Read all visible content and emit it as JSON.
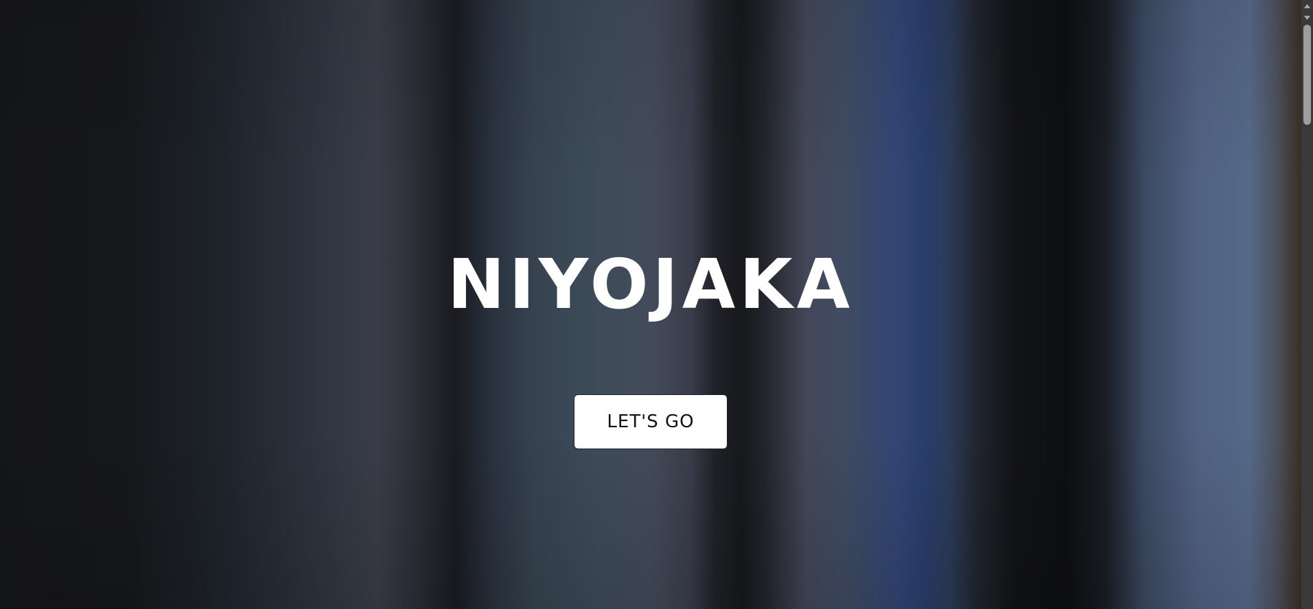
{
  "hero": {
    "title": "NIYOJAKA",
    "cta_label": "LET'S GO"
  },
  "icons": {
    "scroll_up": "chevron-up-icon",
    "scroll_down": "chevron-down-icon"
  },
  "colors": {
    "title": "#ffffff",
    "button_bg": "#ffffff",
    "button_text": "#111111",
    "scrollbar_track": "#3a3a3a",
    "scrollbar_thumb": "#9e9e9e"
  }
}
